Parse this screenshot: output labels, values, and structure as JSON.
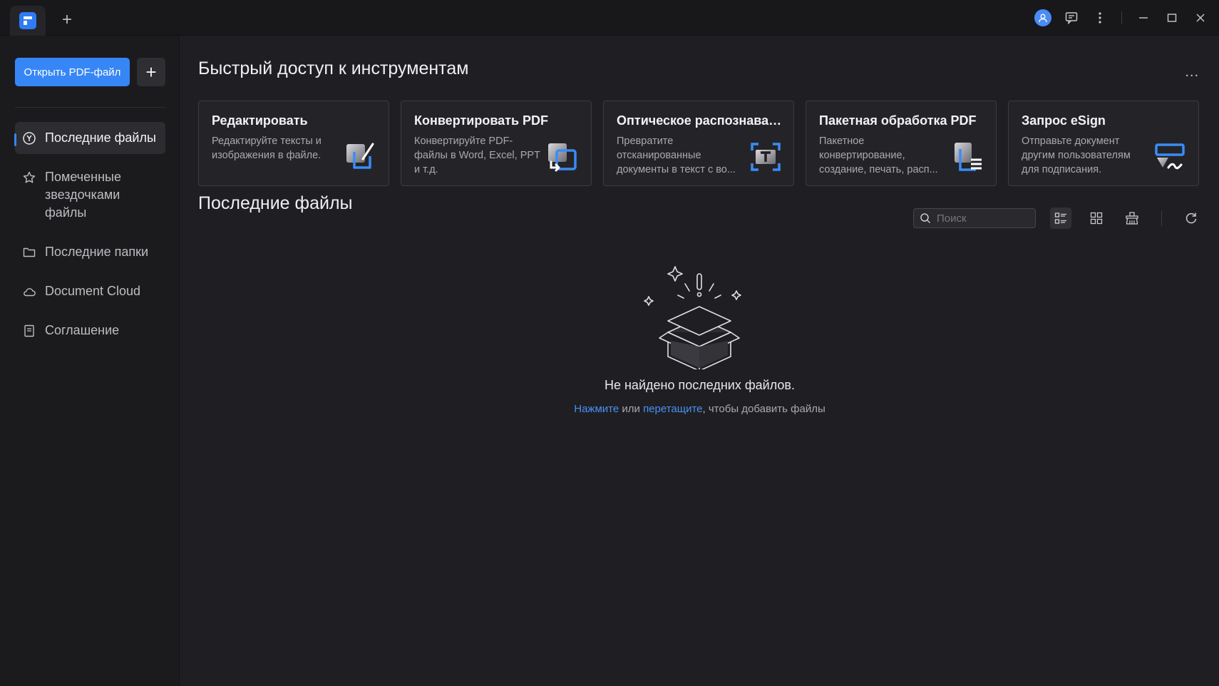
{
  "titlebar": {
    "new_tab_label": "+"
  },
  "sidebar": {
    "open_button": "Открыть PDF-файл",
    "plus_button": "+",
    "items": [
      {
        "label": "Последние файлы",
        "icon": "clock-icon",
        "active": true
      },
      {
        "label": "Помеченные звездочками файлы",
        "icon": "star-icon",
        "active": false
      },
      {
        "label": "Последние папки",
        "icon": "folder-icon",
        "active": false
      },
      {
        "label": "Document Cloud",
        "icon": "cloud-icon",
        "active": false
      },
      {
        "label": "Соглашение",
        "icon": "document-icon",
        "active": false
      }
    ]
  },
  "quick_access": {
    "title": "Быстрый доступ к инструментам",
    "more": "...",
    "cards": [
      {
        "title": "Редактировать",
        "desc": "Редактируйте тексты и изображения в файле.",
        "icon": "edit-icon"
      },
      {
        "title": "Конвертировать PDF",
        "desc": "Конвертируйте PDF-файлы в Word, Excel, PPT и т.д.",
        "icon": "convert-icon"
      },
      {
        "title": "Оптическое распознаван...",
        "desc": "Превратите отсканированные документы в текст с во...",
        "icon": "ocr-icon"
      },
      {
        "title": "Пакетная обработка PDF",
        "desc": "Пакетное конвертирование, создание, печать, расп...",
        "icon": "batch-icon"
      },
      {
        "title": "Запрос eSign",
        "desc": "Отправьте документ другим пользователям для подписания.",
        "icon": "esign-icon"
      }
    ]
  },
  "recent": {
    "title": "Последние файлы",
    "search_placeholder": "Поиск",
    "empty_text": "Не найдено последних файлов.",
    "hint_click": "Нажмите",
    "hint_or": " или ",
    "hint_drag": "перетащите",
    "hint_rest": ", чтобы добавить файлы"
  },
  "colors": {
    "accent": "#3686f5",
    "background": "#1f1f23",
    "sidebar": "#1b1b1e"
  }
}
